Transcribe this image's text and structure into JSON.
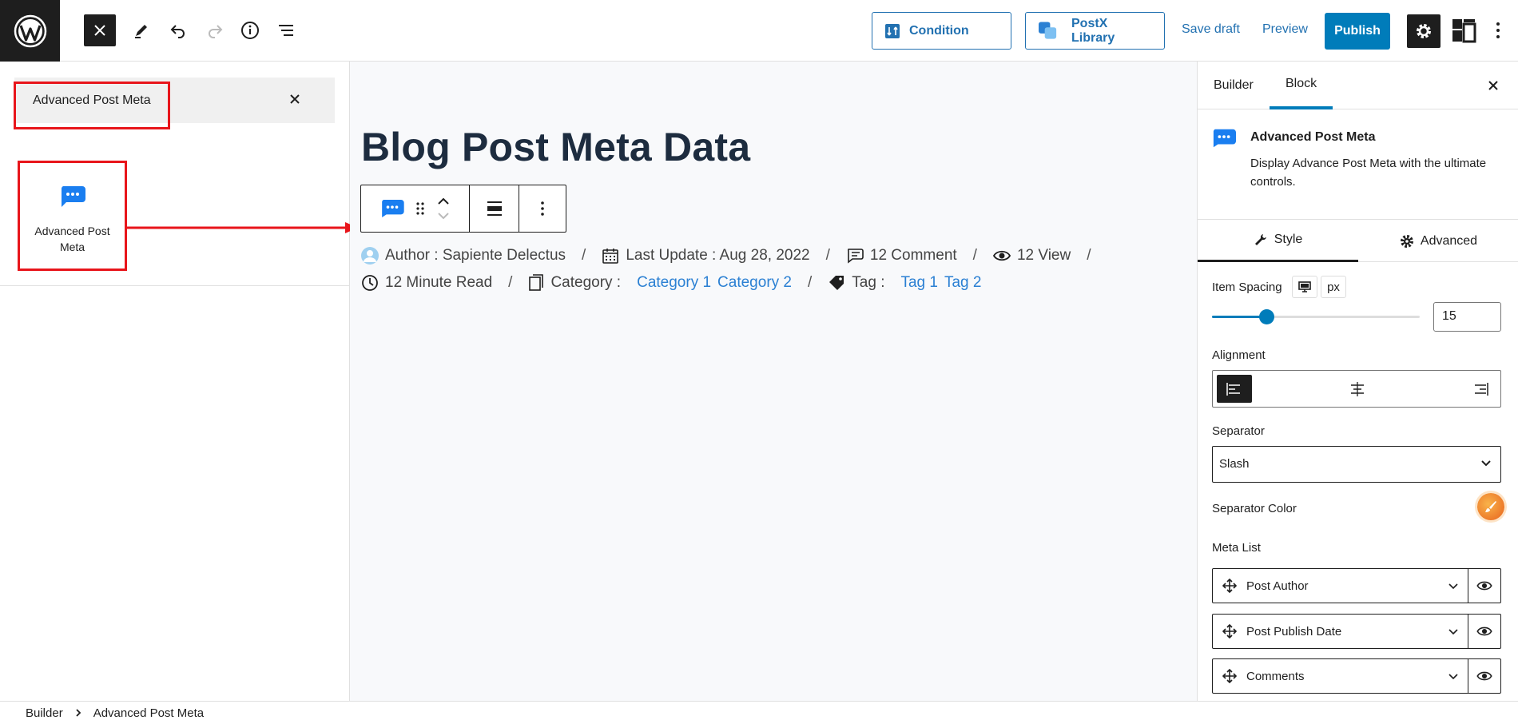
{
  "toolbar": {
    "condition_label": "Condition",
    "library_label": "PostX Library",
    "save_draft_label": "Save draft",
    "preview_label": "Preview",
    "publish_label": "Publish"
  },
  "inserter": {
    "search_value": "Advanced Post Meta",
    "block_label": "Advanced Post Meta"
  },
  "canvas": {
    "post_title": "Blog Post Meta Data",
    "meta": {
      "author": "Author : Sapiente Delectus",
      "last_update": "Last Update : Aug 28, 2022",
      "comments": "12 Comment",
      "views": "12 View",
      "read_time": "12 Minute Read",
      "category_label": "Category :",
      "category_1": "Category 1",
      "category_2": "Category 2",
      "tag_label": "Tag :",
      "tag_1": "Tag 1",
      "tag_2": "Tag 2",
      "separator": "/"
    }
  },
  "sidebar": {
    "tab_builder": "Builder",
    "tab_block": "Block",
    "block_title": "Advanced Post Meta",
    "block_desc": "Display Advance Post Meta with the ultimate controls.",
    "style_tab": "Style",
    "advanced_tab": "Advanced",
    "item_spacing_label": "Item Spacing",
    "unit": "px",
    "item_spacing_value": "15",
    "item_spacing_fraction": 0.26,
    "alignment_label": "Alignment",
    "separator_label": "Separator",
    "separator_value": "Slash",
    "separator_color_label": "Separator Color",
    "meta_list_label": "Meta List",
    "meta_items": [
      "Post Author",
      "Post Publish Date",
      "Comments"
    ]
  },
  "footer": {
    "crumb_1": "Builder",
    "crumb_2": "Advanced Post Meta"
  },
  "colors": {
    "accent": "#007cba",
    "highlight": "#e8151b",
    "link": "#2b80d3"
  }
}
